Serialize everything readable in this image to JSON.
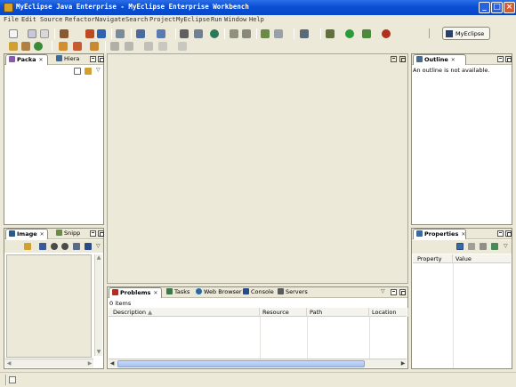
{
  "window": {
    "title": "MyEclipse Java Enterprise - MyEclipse Enterprise Workbench"
  },
  "menu": [
    "File",
    "Edit",
    "Source",
    "Refactor",
    "Navigate",
    "Search",
    "Project",
    "MyEclipse",
    "Run",
    "Window",
    "Help"
  ],
  "perspective": {
    "label": "MyEclipse"
  },
  "views": {
    "packages": {
      "tabs": [
        "Packa",
        "Hiera"
      ]
    },
    "image": {
      "tabs": [
        "Image",
        "Snipp"
      ]
    },
    "outline": {
      "tab": "Outline",
      "message": "An outline is not available."
    },
    "properties": {
      "tab": "Properties",
      "columns": [
        "Property",
        "Value"
      ]
    },
    "bottom": {
      "tabs": [
        "Problems",
        "Tasks",
        "Web Browser",
        "Console",
        "Servers"
      ],
      "summary": "0 items",
      "columns": [
        "Description",
        "Resource",
        "Path",
        "Location"
      ]
    }
  },
  "colors": {
    "titlebar": "#0a4fd4",
    "workbench_bg": "#ece9d8",
    "view_border": "#8f8d7e"
  }
}
